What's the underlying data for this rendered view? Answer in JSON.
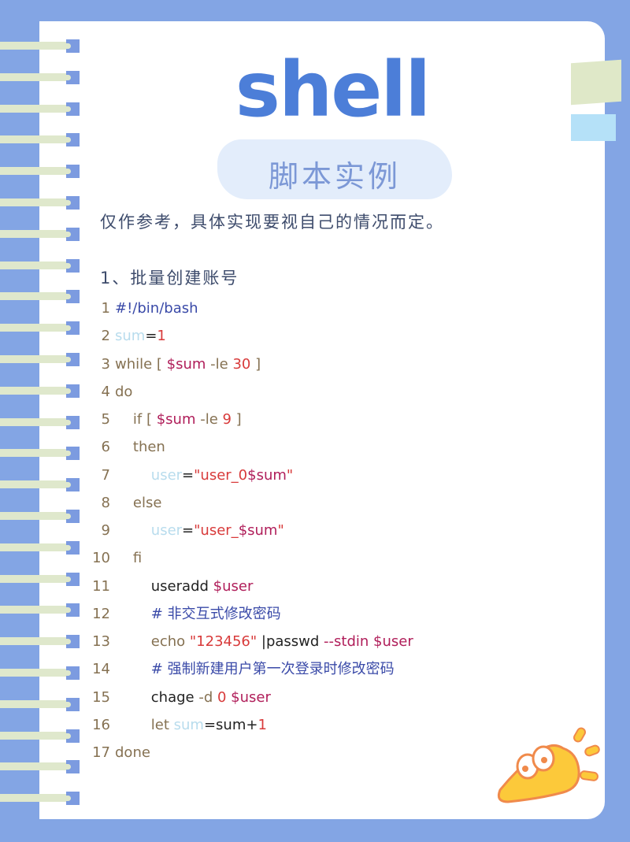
{
  "title": "shell",
  "subtitle": "脚本实例",
  "intro": "仅作参考，具体实现要视自己的情况而定。",
  "section_heading": "1、批量创建账号",
  "code": {
    "language": "bash",
    "lines": [
      {
        "n": "1",
        "text": "#!/bin/bash"
      },
      {
        "n": "2",
        "text": "sum=1"
      },
      {
        "n": "3",
        "text": "while [ $sum -le 30 ]"
      },
      {
        "n": "4",
        "text": "do"
      },
      {
        "n": "5",
        "text": "    if [ $sum -le 9 ]"
      },
      {
        "n": "6",
        "text": "    then"
      },
      {
        "n": "7",
        "text": "        user=\"user_0$sum\""
      },
      {
        "n": "8",
        "text": "    else"
      },
      {
        "n": "9",
        "text": "        user=\"user_$sum\""
      },
      {
        "n": "10",
        "text": "    fi"
      },
      {
        "n": "11",
        "text": "        useradd $user"
      },
      {
        "n": "12",
        "text": "        # 非交互式修改密码"
      },
      {
        "n": "13",
        "text": "        echo \"123456\" |passwd --stdin $user"
      },
      {
        "n": "14",
        "text": "        # 强制新建用户第一次登录时修改密码"
      },
      {
        "n": "15",
        "text": "        chage -d 0 $user"
      },
      {
        "n": "16",
        "text": "        let sum=sum+1"
      },
      {
        "n": "17",
        "text": "done"
      }
    ]
  },
  "colors": {
    "background": "#83a5e4",
    "title": "#4c7ed8",
    "subtitle": "#7c98d6",
    "keyword": "#857152",
    "number": "#d83a3a",
    "variable": "#b01e5a",
    "comment": "#3a4aa8"
  },
  "decor": {
    "ring_count": 25,
    "mascot": "megaphone-mascot-icon"
  }
}
